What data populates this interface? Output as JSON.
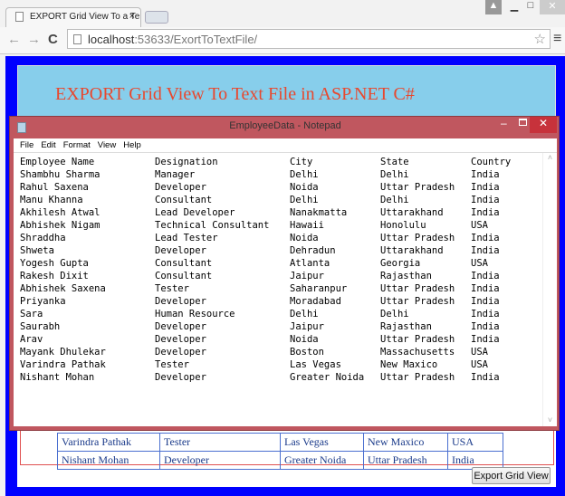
{
  "browser": {
    "tab_title": "EXPORT Grid View To a Te",
    "url_host": "localhost",
    "url_rest": ":53633/ExortToTextFile/"
  },
  "page": {
    "title": "EXPORT Grid View To Text File in ASP.NET C#",
    "export_button": "Export Grid View",
    "grid_rows": [
      [
        "Varindra Pathak",
        "Tester",
        "Las Vegas",
        "New Maxico",
        "USA"
      ],
      [
        "Nishant Mohan",
        "Developer",
        "Greater Noida",
        "Uttar Pradesh",
        "India"
      ]
    ]
  },
  "notepad": {
    "title": "EmployeeData - Notepad",
    "menu": [
      "File",
      "Edit",
      "Format",
      "View",
      "Help"
    ],
    "headers": [
      "Employee Name",
      "Designation",
      "City",
      "State",
      "Country"
    ],
    "rows": [
      [
        "Shambhu Sharma",
        "Manager",
        "Delhi",
        "Delhi",
        "India"
      ],
      [
        "Rahul Saxena",
        "Developer",
        "Noida",
        "Uttar Pradesh",
        "India"
      ],
      [
        "Manu Khanna",
        "Consultant",
        "Delhi",
        "Delhi",
        "India"
      ],
      [
        "Akhilesh Atwal",
        "Lead Developer",
        "Nanakmatta",
        "Uttarakhand",
        "India"
      ],
      [
        "Abhishek Nigam",
        "Technical Consultant",
        "Hawaii",
        "Honolulu",
        "USA"
      ],
      [
        "Shraddha",
        "Lead Tester",
        "Noida",
        "Uttar Pradesh",
        "India"
      ],
      [
        "Shweta",
        "Developer",
        "Dehradun",
        "Uttarakhand",
        "India"
      ],
      [
        "Yogesh Gupta",
        "Consultant",
        "Atlanta",
        "Georgia",
        "USA"
      ],
      [
        "Rakesh Dixit",
        "Consultant",
        "Jaipur",
        "Rajasthan",
        "India"
      ],
      [
        "Abhishek Saxena",
        "Tester",
        "Saharanpur",
        "Uttar Pradesh",
        "India"
      ],
      [
        "Priyanka",
        "Developer",
        "Moradabad",
        "Uttar Pradesh",
        "India"
      ],
      [
        "Sara",
        "Human Resource",
        "Delhi",
        "Delhi",
        "India"
      ],
      [
        "Saurabh",
        "Developer",
        "Jaipur",
        "Rajasthan",
        "India"
      ],
      [
        "Arav",
        "Developer",
        "Noida",
        "Uttar Pradesh",
        "India"
      ],
      [
        "Mayank Dhulekar",
        "Developer",
        "Boston",
        "Massachusetts",
        "USA"
      ],
      [
        "Varindra Pathak",
        "Tester",
        "Las Vegas",
        "New Maxico",
        "USA"
      ],
      [
        "Nishant Mohan",
        "Developer",
        "Greater Noida",
        "Uttar Pradesh",
        "India"
      ]
    ]
  }
}
